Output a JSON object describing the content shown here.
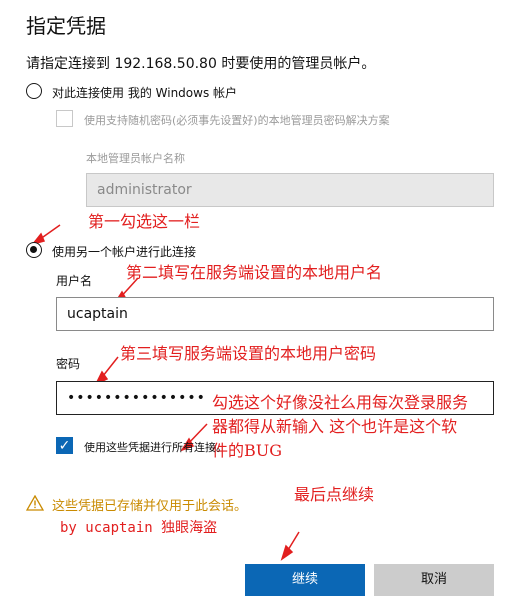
{
  "dialog": {
    "title": "指定凭据",
    "description": "请指定连接到 192.168.50.80 时要使用的管理员帐户。"
  },
  "option_windows": {
    "label": "对此连接使用 我的 Windows 帐户",
    "selected": false
  },
  "randomized_password": {
    "label": "使用支持随机密码(必须事先设置好)的本地管理员密码解决方案",
    "checked": false
  },
  "local_admin": {
    "label": "本地管理员帐户名称",
    "value": "administrator"
  },
  "option_other": {
    "label": "使用另一个帐户进行此连接",
    "selected": true
  },
  "username": {
    "label": "用户名",
    "value": "ucaptain"
  },
  "password": {
    "label": "密码",
    "value": "•••••••••••••••"
  },
  "remember": {
    "label": "使用这些凭据进行所有连接。",
    "checked": true,
    "check_glyph": "✓"
  },
  "warning": {
    "icon": "warning-icon",
    "text": "这些凭据已存储并仅用于此会话。"
  },
  "buttons": {
    "continue": "继续",
    "cancel": "取消"
  },
  "annotations": {
    "step1": "第一勾选这一栏",
    "step2": "第二填写在服务端设置的本地用户名",
    "step3": "第三填写服务端设置的本地用户密码",
    "note_line1": "勾选这个好像没社么用每次登录服务",
    "note_line2": "器都得从新输入  这个也许是这个软",
    "note_line3": "件的BUG",
    "last": "最后点继续",
    "author": "by ucaptain 独眼海盗"
  },
  "colors": {
    "accent": "#0b67b5",
    "annotation": "#e21f1f",
    "warning": "#c98a00"
  }
}
